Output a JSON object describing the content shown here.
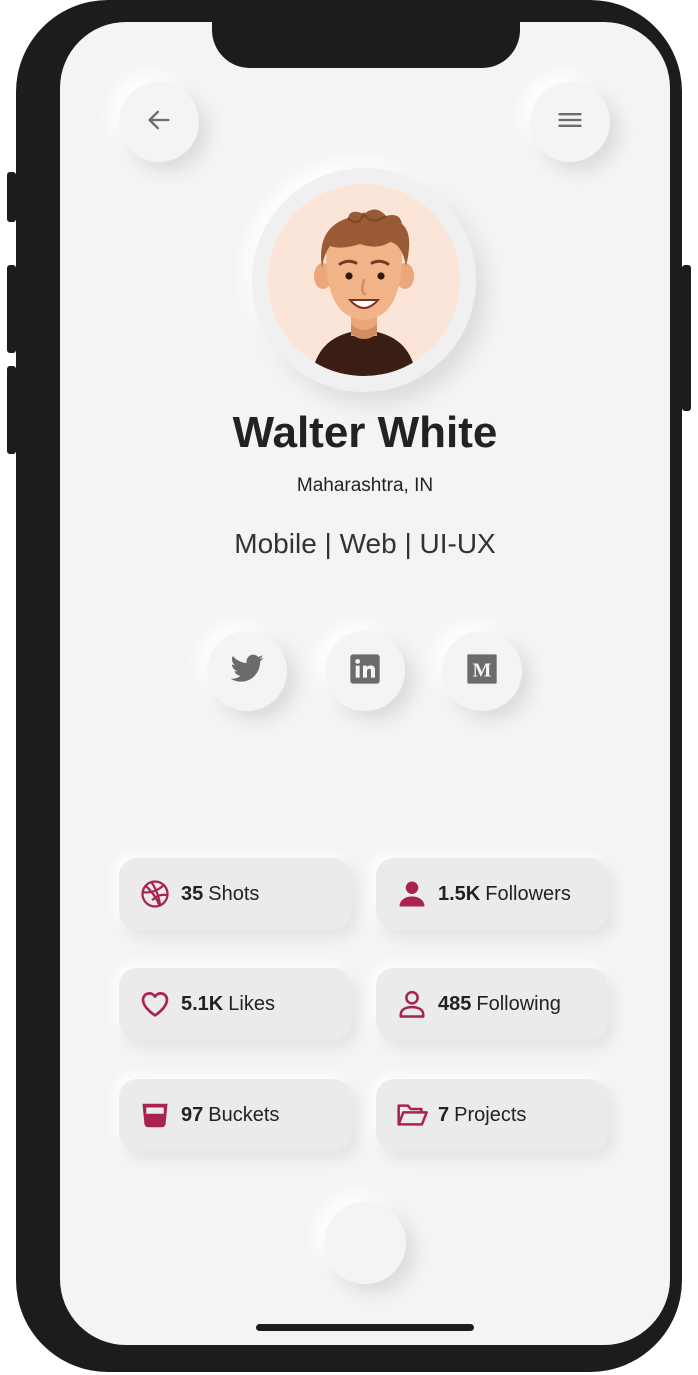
{
  "profile": {
    "name": "Walter White",
    "location": "Maharashtra, IN",
    "roles": "Mobile | Web | UI-UX"
  },
  "header": {
    "back_icon": "arrow-left-icon",
    "menu_icon": "hamburger-menu-icon"
  },
  "social": [
    {
      "name": "twitter",
      "icon": "twitter-icon"
    },
    {
      "name": "linkedin",
      "icon": "linkedin-icon"
    },
    {
      "name": "medium",
      "icon": "medium-icon"
    }
  ],
  "stats": {
    "shots": {
      "value": "35",
      "label": "Shots",
      "icon": "dribbble-icon"
    },
    "followers": {
      "value": "1.5K",
      "label": "Followers",
      "icon": "user-solid-icon"
    },
    "likes": {
      "value": "5.1K",
      "label": "Likes",
      "icon": "heart-icon"
    },
    "following": {
      "value": "485",
      "label": "Following",
      "icon": "user-outline-icon"
    },
    "buckets": {
      "value": "97",
      "label": "Buckets",
      "icon": "bucket-icon"
    },
    "projects": {
      "value": "7",
      "label": "Projects",
      "icon": "folder-open-icon"
    }
  },
  "colors": {
    "accent": "#a8234f",
    "background": "#f4f4f4",
    "frame": "#1c1c1c",
    "icon_gray": "#6b6b6b"
  }
}
